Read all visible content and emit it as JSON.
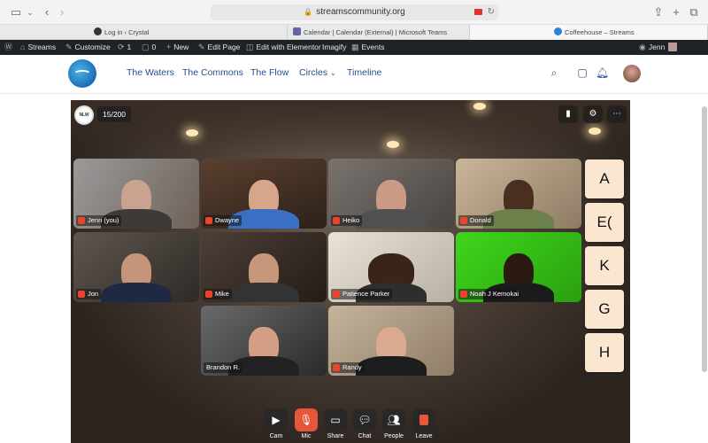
{
  "browser": {
    "url": "streamscommunity.org",
    "tabs": [
      {
        "title": "Log in ‹ Crystal",
        "active": false
      },
      {
        "title": "Calendar | Calendar (External) | Microsoft Teams",
        "active": false
      },
      {
        "title": "Coffeehouse – Streams",
        "active": true
      }
    ]
  },
  "wp_admin_bar": {
    "site_name": "Streams",
    "customize": "Customize",
    "updates_count": "1",
    "comments_count": "0",
    "new_label": "New",
    "edit_page": "Edit Page",
    "edit_elementor": "Edit with Elementor",
    "imagify": "Imagify",
    "events": "Events",
    "user": "Jenn"
  },
  "site_nav": {
    "items": [
      "The Waters",
      "The Commons",
      "The Flow",
      "Circles",
      "Timeline"
    ]
  },
  "meeting": {
    "logo_text": "NLW",
    "participant_count": "15/200",
    "participants": [
      {
        "name": "Jenn (you)",
        "muted": true
      },
      {
        "name": "Dwayne",
        "muted": true
      },
      {
        "name": "Heiko",
        "muted": true
      },
      {
        "name": "Donald",
        "muted": true
      },
      {
        "name": "Jon",
        "muted": true
      },
      {
        "name": "Mike",
        "muted": true
      },
      {
        "name": "Patience Parker",
        "muted": true
      },
      {
        "name": "Noah J Kemokai",
        "muted": true
      },
      {
        "name": "Brandon R.",
        "muted": false
      },
      {
        "name": "Randy",
        "muted": true
      }
    ],
    "letter_tiles": [
      "A",
      "E(",
      "K",
      "G",
      "H"
    ],
    "controls": [
      "Cam",
      "Mic",
      "Share",
      "Chat",
      "People",
      "Leave"
    ]
  },
  "colors": {
    "wp_bar": "#1d2327",
    "nav_text": "#1f4f8f",
    "mic_off": "#e8452c",
    "letter_tile": "#fbe7cf"
  }
}
